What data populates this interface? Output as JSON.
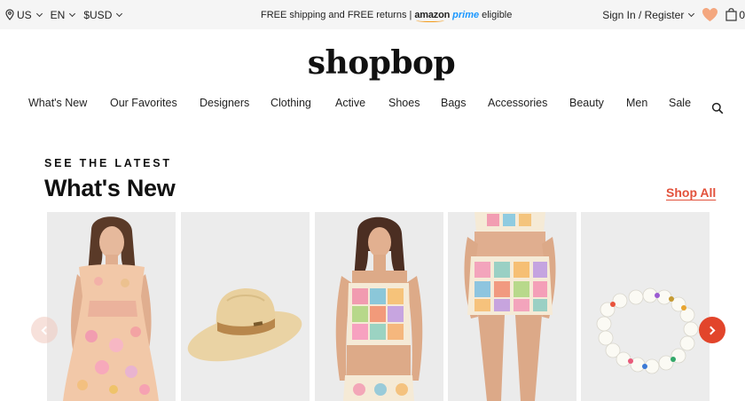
{
  "topbar": {
    "country": "US",
    "language": "EN",
    "currency": "$USD",
    "promo_text": "FREE shipping and FREE returns |",
    "amazon": "amazon",
    "prime": "prime",
    "eligible": "eligible",
    "signin": "Sign In / Register",
    "bag_count": "0"
  },
  "logo": "shopbop",
  "nav": [
    "What's New",
    "Our Favorites",
    "Designers",
    "Clothing",
    "Active",
    "Shoes",
    "Bags",
    "Accessories",
    "Beauty",
    "Men",
    "Sale"
  ],
  "section": {
    "eyebrow": "SEE THE LATEST",
    "title": "What's New",
    "shop_all": "Shop All"
  },
  "colors": {
    "accent": "#e2513b",
    "heart": "#f4a77f",
    "topbar_bg": "#f5f5f5"
  }
}
